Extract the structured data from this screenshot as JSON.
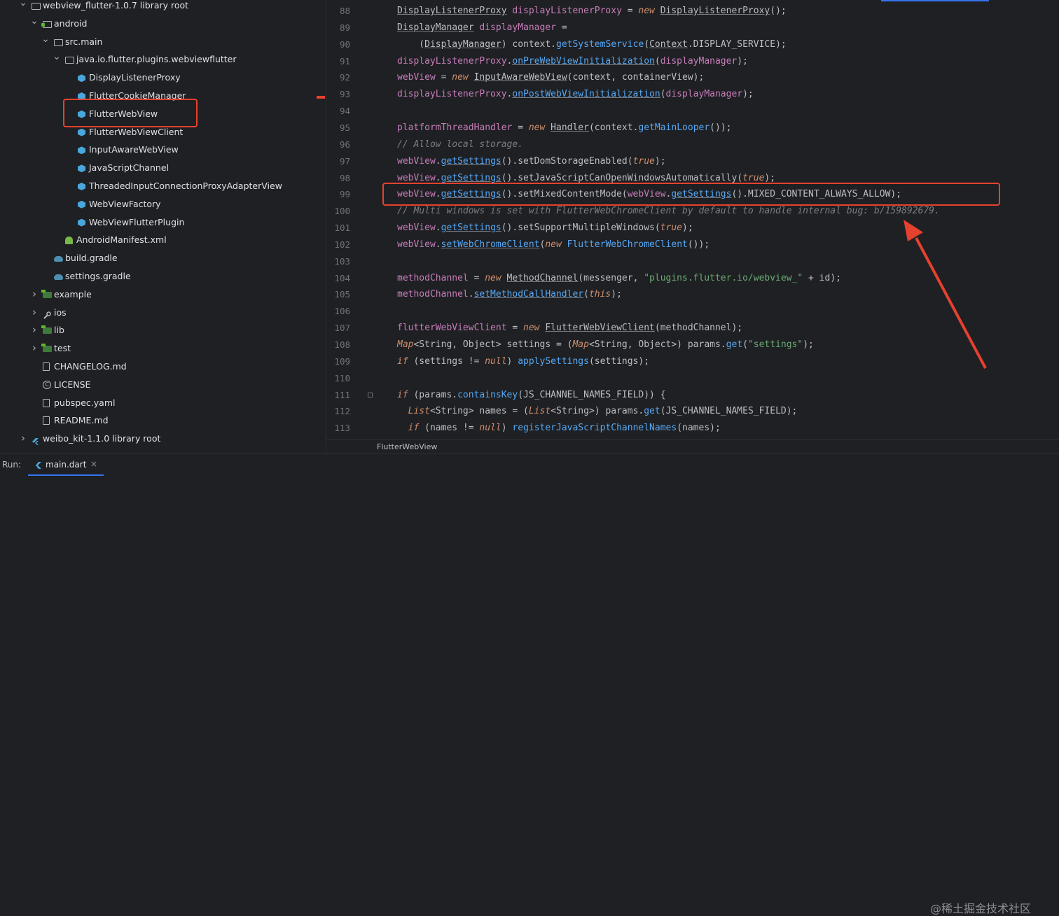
{
  "tree": {
    "items": [
      {
        "label": "webview_flutter-1.0.7 library root",
        "icon": "folder-icon"
      },
      {
        "label": "android",
        "icon": "module-folder-icon"
      },
      {
        "label": "src.main",
        "icon": "folder-icon"
      },
      {
        "label": "java.io.flutter.plugins.webviewflutter",
        "icon": "package-folder-icon"
      },
      {
        "label": "DisplayListenerProxy",
        "icon": "class-icon"
      },
      {
        "label": "FlutterCookieManager",
        "icon": "class-icon"
      },
      {
        "label": "FlutterWebView",
        "icon": "class-icon"
      },
      {
        "label": "FlutterWebViewClient",
        "icon": "class-icon"
      },
      {
        "label": "InputAwareWebView",
        "icon": "class-icon"
      },
      {
        "label": "JavaScriptChannel",
        "icon": "class-icon"
      },
      {
        "label": "ThreadedInputConnectionProxyAdapterView",
        "icon": "class-icon"
      },
      {
        "label": "WebViewFactory",
        "icon": "class-icon"
      },
      {
        "label": "WebViewFlutterPlugin",
        "icon": "class-icon"
      },
      {
        "label": "AndroidManifest.xml",
        "icon": "android-icon"
      },
      {
        "label": "build.gradle",
        "icon": "gradle-icon"
      },
      {
        "label": "settings.gradle",
        "icon": "gradle-icon"
      },
      {
        "label": "example",
        "icon": "green-folder-icon"
      },
      {
        "label": "ios",
        "icon": "wrench-icon"
      },
      {
        "label": "lib",
        "icon": "green-folder-icon"
      },
      {
        "label": "test",
        "icon": "green-folder-icon"
      },
      {
        "label": "CHANGELOG.md",
        "icon": "file-icon"
      },
      {
        "label": "LICENSE",
        "icon": "copyright-icon"
      },
      {
        "label": "pubspec.yaml",
        "icon": "file-icon"
      },
      {
        "label": "README.md",
        "icon": "file-icon"
      },
      {
        "label": "weibo_kit-1.1.0 library root",
        "icon": "flutter-icon"
      }
    ]
  },
  "editor": {
    "line_numbers": [
      "88",
      "89",
      "90",
      "91",
      "92",
      "93",
      "94",
      "95",
      "96",
      "97",
      "98",
      "99",
      "100",
      "101",
      "102",
      "103",
      "104",
      "105",
      "106",
      "107",
      "108",
      "109",
      "110",
      "111",
      "112",
      "113"
    ],
    "lines": [
      [
        [
          "DisplayListenerProxy",
          "ty u"
        ],
        [
          " displayListenerProxy ",
          "m"
        ],
        [
          "= ",
          "p"
        ],
        [
          "new ",
          "i"
        ],
        [
          "DisplayListenerProxy",
          "ty u"
        ],
        [
          "();",
          "p"
        ]
      ],
      [
        [
          "DisplayManager",
          "ty u"
        ],
        [
          " displayManager ",
          "m"
        ],
        [
          "=",
          "p"
        ]
      ],
      [
        [
          "    (",
          "p"
        ],
        [
          "DisplayManager",
          "ty u"
        ],
        [
          ") context.",
          "p"
        ],
        [
          "getSystemService",
          "f"
        ],
        [
          "(",
          "p"
        ],
        [
          "Context",
          "ty u"
        ],
        [
          ".DISPLAY_SERVICE);",
          "p"
        ]
      ],
      [
        [
          "displayListenerProxy",
          "m"
        ],
        [
          ".",
          "p"
        ],
        [
          "onPreWebViewInitialization",
          "f u"
        ],
        [
          "(",
          "p"
        ],
        [
          "displayManager",
          "m"
        ],
        [
          ");",
          "p"
        ]
      ],
      [
        [
          "webView",
          "m"
        ],
        [
          " = ",
          "p"
        ],
        [
          "new ",
          "i"
        ],
        [
          "InputAwareWebView",
          "ty u"
        ],
        [
          "(context, containerView);",
          "p"
        ]
      ],
      [
        [
          "displayListenerProxy",
          "m"
        ],
        [
          ".",
          "p"
        ],
        [
          "onPostWebViewInitialization",
          "f u"
        ],
        [
          "(",
          "p"
        ],
        [
          "displayManager",
          "m"
        ],
        [
          ");",
          "p"
        ]
      ],
      [],
      [
        [
          "platformThreadHandler",
          "m"
        ],
        [
          " = ",
          "p"
        ],
        [
          "new ",
          "i"
        ],
        [
          "Handler",
          "ty u"
        ],
        [
          "(context.",
          "p"
        ],
        [
          "getMainLooper",
          "f"
        ],
        [
          "());",
          "p"
        ]
      ],
      [
        [
          "// Allow local storage.",
          "c"
        ]
      ],
      [
        [
          "webView",
          "m"
        ],
        [
          ".",
          "p"
        ],
        [
          "getSettings",
          "f u"
        ],
        [
          "().setDomStorageEnabled(",
          "p"
        ],
        [
          "true",
          "i"
        ],
        [
          ");",
          "p"
        ]
      ],
      [
        [
          "webView",
          "m"
        ],
        [
          ".",
          "p"
        ],
        [
          "getSettings",
          "f u"
        ],
        [
          "().setJavaScriptCanOpenWindowsAutomatically(",
          "p"
        ],
        [
          "true",
          "i"
        ],
        [
          ");",
          "p"
        ]
      ],
      [
        [
          "webView",
          "m"
        ],
        [
          ".",
          "p"
        ],
        [
          "getSettings",
          "f u"
        ],
        [
          "().setMixedContentMode(",
          "p"
        ],
        [
          "webView",
          "m"
        ],
        [
          ".",
          "p"
        ],
        [
          "getSettings",
          "f u"
        ],
        [
          "().MIXED_CONTENT_ALWAYS_ALLOW);",
          "p"
        ]
      ],
      [
        [
          "// Multi windows is set with FlutterWebChromeClient by default to handle internal bug: b/159892679.",
          "c"
        ]
      ],
      [
        [
          "webView",
          "m"
        ],
        [
          ".",
          "p"
        ],
        [
          "getSettings",
          "f u"
        ],
        [
          "().setSupportMultipleWindows(",
          "p"
        ],
        [
          "true",
          "i"
        ],
        [
          ");",
          "p"
        ]
      ],
      [
        [
          "webView",
          "m"
        ],
        [
          ".",
          "p"
        ],
        [
          "setWebChromeClient",
          "f u"
        ],
        [
          "(",
          "p"
        ],
        [
          "new ",
          "i"
        ],
        [
          "FlutterWebChromeClient",
          "f"
        ],
        [
          "());",
          "p"
        ]
      ],
      [],
      [
        [
          "methodChannel",
          "m"
        ],
        [
          " = ",
          "p"
        ],
        [
          "new ",
          "i"
        ],
        [
          "MethodChannel",
          "ty u"
        ],
        [
          "(messenger, ",
          "p"
        ],
        [
          "\"plugins.flutter.io/webview_\"",
          "s"
        ],
        [
          " + id);",
          "p"
        ]
      ],
      [
        [
          "methodChannel",
          "m"
        ],
        [
          ".",
          "p"
        ],
        [
          "setMethodCallHandler",
          "f u"
        ],
        [
          "(",
          "p"
        ],
        [
          "this",
          "i"
        ],
        [
          ");",
          "p"
        ]
      ],
      [],
      [
        [
          "flutterWebViewClient",
          "m"
        ],
        [
          " = ",
          "p"
        ],
        [
          "new ",
          "i"
        ],
        [
          "FlutterWebViewClient",
          "ty u"
        ],
        [
          "(methodChannel);",
          "p"
        ]
      ],
      [
        [
          "Map",
          "i"
        ],
        [
          "<String, Object> settings = (",
          "p"
        ],
        [
          "Map",
          "i"
        ],
        [
          "<String, Object>) params.",
          "p"
        ],
        [
          "get",
          "f"
        ],
        [
          "(",
          "p"
        ],
        [
          "\"settings\"",
          "s"
        ],
        [
          ");",
          "p"
        ]
      ],
      [
        [
          "if ",
          "i"
        ],
        [
          "(settings != ",
          "p"
        ],
        [
          "null",
          "i"
        ],
        [
          ") ",
          "p"
        ],
        [
          "applySettings",
          "f"
        ],
        [
          "(settings);",
          "p"
        ]
      ],
      [],
      [
        [
          "if ",
          "i"
        ],
        [
          "(params.",
          "p"
        ],
        [
          "containsKey",
          "f"
        ],
        [
          "(JS_CHANNEL_NAMES_FIELD)) {",
          "p"
        ]
      ],
      [
        [
          "  List",
          "i"
        ],
        [
          "<String> names = (",
          "p"
        ],
        [
          "List",
          "i"
        ],
        [
          "<String>) params.",
          "p"
        ],
        [
          "get",
          "f"
        ],
        [
          "(JS_CHANNEL_NAMES_FIELD);",
          "p"
        ]
      ],
      [
        [
          "  if ",
          "i"
        ],
        [
          "(names != ",
          "p"
        ],
        [
          "null",
          "i"
        ],
        [
          ") ",
          "p"
        ],
        [
          "registerJavaScriptChannelNames",
          "f"
        ],
        [
          "(names);",
          "p"
        ]
      ]
    ],
    "breadcrumb": "FlutterWebView"
  },
  "runbar": {
    "label": "Run:",
    "tab_label": "main.dart",
    "close": "×"
  },
  "watermark": "@稀土掘金技术社区",
  "colors": {
    "accent": "#3574f0",
    "annotation": "#e5412f"
  }
}
